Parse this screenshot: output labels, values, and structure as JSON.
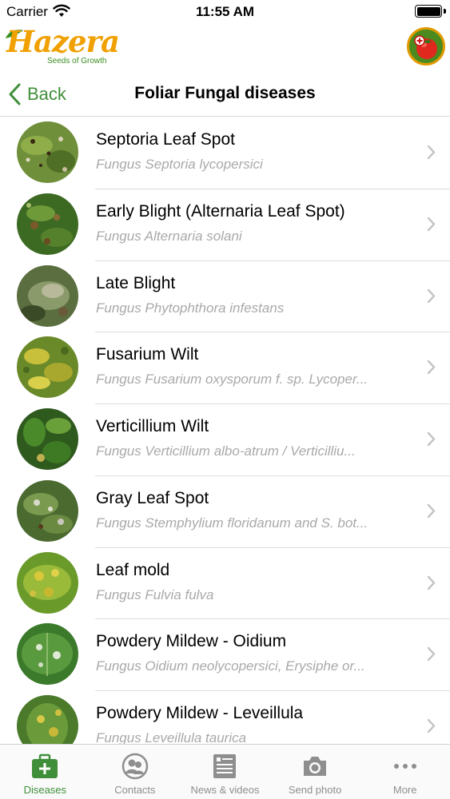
{
  "status_bar": {
    "carrier": "Carrier",
    "time": "11:55 AM"
  },
  "brand": {
    "logo_text": "Hazera",
    "tagline": "Seeds of Growth",
    "accent_color": "#3f8f3a"
  },
  "nav": {
    "back_label": "Back",
    "title": "Foliar Fungal diseases"
  },
  "diseases": [
    {
      "name": "Septoria Leaf Spot",
      "pathogen": "Fungus Septoria lycopersici"
    },
    {
      "name": "Early Blight (Alternaria Leaf Spot)",
      "pathogen": "Fungus Alternaria solani"
    },
    {
      "name": "Late Blight",
      "pathogen": "Fungus Phytophthora infestans"
    },
    {
      "name": "Fusarium Wilt",
      "pathogen": "Fungus Fusarium oxysporum f. sp. Lycoper..."
    },
    {
      "name": "Verticillium Wilt",
      "pathogen": "Fungus Verticillium albo-atrum / Verticilliu..."
    },
    {
      "name": "Gray Leaf Spot",
      "pathogen": "Fungus Stemphylium floridanum and S. bot..."
    },
    {
      "name": "Leaf mold",
      "pathogen": "Fungus Fulvia fulva"
    },
    {
      "name": "Powdery Mildew - Oidium",
      "pathogen": "Fungus Oidium neolycopersici, Erysiphe or..."
    },
    {
      "name": "Powdery Mildew - Leveillula",
      "pathogen": "Fungus Leveillula taurica"
    }
  ],
  "tabs": [
    {
      "label": "Diseases",
      "icon": "medical-kit-icon",
      "active": true
    },
    {
      "label": "Contacts",
      "icon": "contacts-icon",
      "active": false
    },
    {
      "label": "News & videos",
      "icon": "news-icon",
      "active": false
    },
    {
      "label": "Send photo",
      "icon": "camera-icon",
      "active": false
    },
    {
      "label": "More",
      "icon": "more-icon",
      "active": false
    }
  ]
}
